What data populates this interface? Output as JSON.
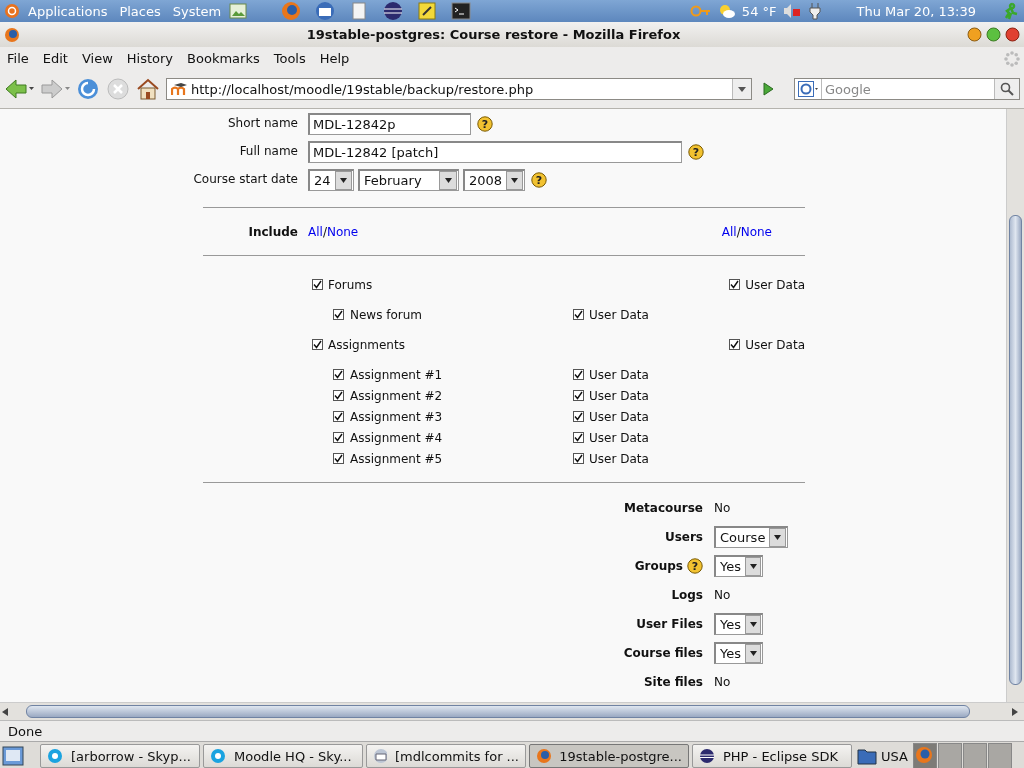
{
  "panel": {
    "menus": [
      "Applications",
      "Places",
      "System"
    ],
    "weather": "54 °F",
    "clock": "Thu Mar 20, 13:39"
  },
  "window": {
    "title": "19stable-postgres: Course restore - Mozilla Firefox"
  },
  "menu": [
    "File",
    "Edit",
    "View",
    "History",
    "Bookmarks",
    "Tools",
    "Help"
  ],
  "nav": {
    "url": "http://localhost/moodle/19stable/backup/restore.php",
    "search_placeholder": "Google"
  },
  "form": {
    "fields": [
      {
        "label": "Short name",
        "value": "MDL-12842p",
        "kind": "short",
        "help": "?"
      },
      {
        "label": "Full name",
        "value": "MDL-12842 [patch]",
        "kind": "long",
        "help": "?"
      }
    ],
    "date": {
      "label": "Course start date",
      "day": "24",
      "month": "February",
      "year": "2008",
      "help": "?"
    },
    "include": {
      "label": "Include",
      "all": "All",
      "sep": "/",
      "none": "None",
      "all_right": "All",
      "sep_right": "/",
      "none_right": "None"
    },
    "modules": [
      {
        "name": "Forums",
        "checked": true,
        "user_data": "User Data",
        "user_data_checked": true,
        "instances": [
          {
            "name": "News forum",
            "checked": true,
            "user_data": "User Data",
            "user_data_checked": true
          }
        ]
      },
      {
        "name": "Assignments",
        "checked": true,
        "user_data": "User Data",
        "user_data_checked": true,
        "instances": [
          {
            "name": "Assignment #1",
            "checked": true,
            "user_data": "User Data",
            "user_data_checked": true
          },
          {
            "name": "Assignment #2",
            "checked": true,
            "user_data": "User Data",
            "user_data_checked": true
          },
          {
            "name": "Assignment #3",
            "checked": true,
            "user_data": "User Data",
            "user_data_checked": true
          },
          {
            "name": "Assignment #4",
            "checked": true,
            "user_data": "User Data",
            "user_data_checked": true
          },
          {
            "name": "Assignment #5",
            "checked": true,
            "user_data": "User Data",
            "user_data_checked": true
          }
        ]
      }
    ],
    "options": [
      {
        "label": "Metacourse",
        "kind": "text",
        "value": "No"
      },
      {
        "label": "Users",
        "kind": "select",
        "value": "Course"
      },
      {
        "label": "Groups",
        "kind": "select",
        "value": "Yes",
        "help": "?"
      },
      {
        "label": "Logs",
        "kind": "text",
        "value": "No"
      },
      {
        "label": "User Files",
        "kind": "select",
        "value": "Yes"
      },
      {
        "label": "Course files",
        "kind": "select",
        "value": "Yes"
      },
      {
        "label": "Site files",
        "kind": "text",
        "value": "No"
      }
    ]
  },
  "status_bar": "Done",
  "taskbar": [
    {
      "label": "[arborrow - Skyp...",
      "kind": "chat",
      "selected": false
    },
    {
      "label": "Moodle HQ - Sky...",
      "kind": "chat",
      "selected": false
    },
    {
      "label": "[mdlcommits for ...",
      "kind": "mail",
      "selected": false
    },
    {
      "label": "19stable-postgre...",
      "kind": "browser",
      "selected": true
    },
    {
      "label": "PHP - Eclipse SDK",
      "kind": "ide",
      "selected": false
    }
  ],
  "keyboard": "USA"
}
